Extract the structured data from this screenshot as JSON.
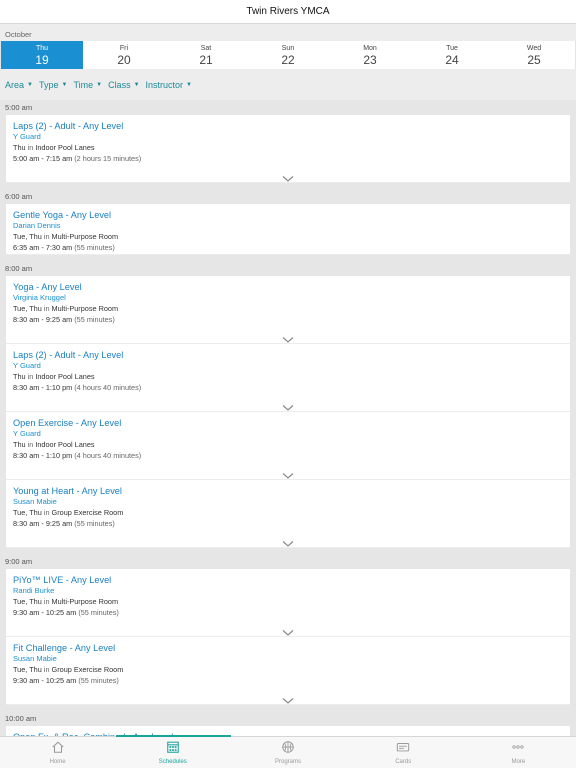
{
  "app": {
    "title": "Twin Rivers YMCA"
  },
  "calendar": {
    "month": "October",
    "days": [
      {
        "dow": "Thu",
        "num": "19",
        "active": true
      },
      {
        "dow": "Fri",
        "num": "20"
      },
      {
        "dow": "Sat",
        "num": "21"
      },
      {
        "dow": "Sun",
        "num": "22"
      },
      {
        "dow": "Mon",
        "num": "23"
      },
      {
        "dow": "Tue",
        "num": "24"
      },
      {
        "dow": "Wed",
        "num": "25"
      }
    ]
  },
  "filters": [
    "Area",
    "Type",
    "Time",
    "Class",
    "Instructor"
  ],
  "sections": [
    {
      "time": "5:00 am",
      "classes": [
        {
          "title": "Laps (2) - Adult - Any Level",
          "instructor": "Y Guard",
          "days": "Thu",
          "location": "Indoor Pool Lanes",
          "time": "5:00 am - 7:15 am",
          "duration": "(2 hours 15 minutes)",
          "expandable": true
        }
      ]
    },
    {
      "time": "6:00 am",
      "classes": [
        {
          "title": "Gentle Yoga - Any Level",
          "instructor": "Darian Dennis",
          "days": "Tue, Thu",
          "location": "Multi-Purpose Room",
          "time": "6:35 am - 7:30 am",
          "duration": "(55 minutes)",
          "expandable": false
        }
      ]
    },
    {
      "time": "8:00 am",
      "classes": [
        {
          "title": "Yoga - Any Level",
          "instructor": "Virginia Kruggel",
          "days": "Tue, Thu",
          "location": "Multi-Purpose Room",
          "time": "8:30 am - 9:25 am",
          "duration": "(55 minutes)",
          "expandable": true
        },
        {
          "title": "Laps (2) - Adult - Any Level",
          "instructor": "Y Guard",
          "days": "Thu",
          "location": "Indoor Pool Lanes",
          "time": "8:30 am - 1:10 pm",
          "duration": "(4 hours 40 minutes)",
          "expandable": true
        },
        {
          "title": "Open Exercise - Any Level",
          "instructor": "Y Guard",
          "days": "Thu",
          "location": "Indoor Pool Lanes",
          "time": "8:30 am - 1:10 pm",
          "duration": "(4 hours 40 minutes)",
          "expandable": true
        },
        {
          "title": "Young at Heart - Any Level",
          "instructor": "Susan Mabie",
          "days": "Tue, Thu",
          "location": "Group Exercise Room",
          "time": "8:30 am - 9:25 am",
          "duration": "(55 minutes)",
          "expandable": true
        }
      ]
    },
    {
      "time": "9:00 am",
      "classes": [
        {
          "title": "PiYo™ LIVE - Any Level",
          "instructor": "Randi Burke",
          "days": "Tue, Thu",
          "location": "Multi-Purpose Room",
          "time": "9:30 am - 10:25 am",
          "duration": "(55 minutes)",
          "expandable": true
        },
        {
          "title": "Fit Challenge - Any Level",
          "instructor": "Susan Mabie",
          "days": "Tue, Thu",
          "location": "Group Exercise Room",
          "time": "9:30 am - 10:25 am",
          "duration": "(55 minutes)",
          "expandable": true
        }
      ]
    },
    {
      "time": "10:00 am",
      "classes": [
        {
          "title": "Open Fx. & Rec. Combined - Any Level",
          "instructor": "",
          "days": "",
          "location": "",
          "time": "",
          "duration": "",
          "expandable": false
        }
      ]
    }
  ],
  "in_word": "in",
  "tabs": [
    {
      "label": "Home",
      "icon": "home-icon"
    },
    {
      "label": "Schedules",
      "icon": "calendar-icon",
      "active": true
    },
    {
      "label": "Programs",
      "icon": "basketball-icon"
    },
    {
      "label": "Cards",
      "icon": "card-icon"
    },
    {
      "label": "More",
      "icon": "more-icon"
    }
  ],
  "colors": {
    "accent_blue": "#1a8fd1",
    "accent_teal": "#1aa59a",
    "filter_teal": "#1e8a99"
  }
}
